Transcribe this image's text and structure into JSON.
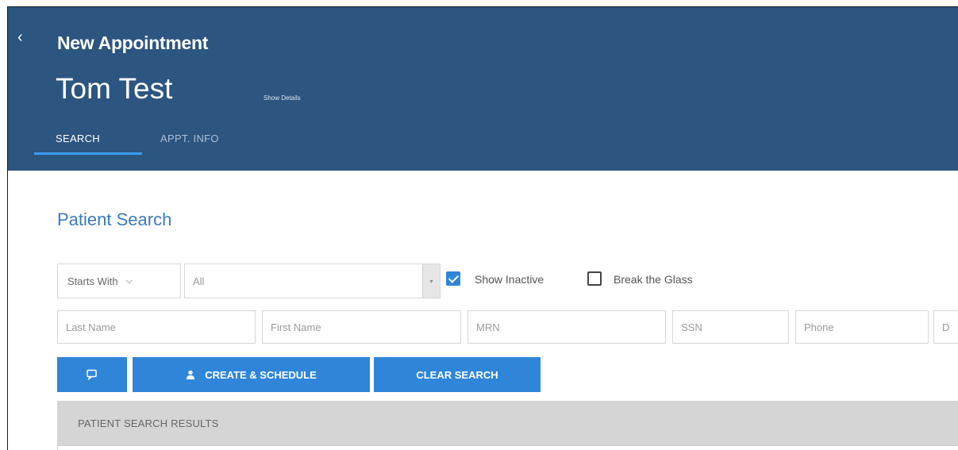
{
  "header": {
    "title": "New Appointment",
    "patient_name": "Tom Test",
    "show_details": "Show Details",
    "tabs": [
      {
        "label": "SEARCH",
        "active": true
      },
      {
        "label": "APPT. INFO",
        "active": false
      }
    ]
  },
  "patient_search": {
    "title": "Patient Search",
    "match_mode": "Starts With",
    "scope": "All",
    "show_inactive": {
      "label": "Show Inactive",
      "checked": true
    },
    "break_glass": {
      "label": "Break the Glass",
      "checked": false
    },
    "fields": [
      {
        "placeholder": "Last Name"
      },
      {
        "placeholder": "First Name"
      },
      {
        "placeholder": "MRN"
      },
      {
        "placeholder": "SSN"
      },
      {
        "placeholder": "Phone"
      },
      {
        "placeholder": "D"
      }
    ],
    "buttons": {
      "search_icon": "search-icon",
      "create_schedule": "CREATE & SCHEDULE",
      "clear_search": "CLEAR SEARCH"
    }
  },
  "results": {
    "header": "PATIENT SEARCH RESULTS"
  },
  "colors": {
    "header_bg": "#2c5580",
    "accent": "#2f86d9",
    "tab_underline": "#3d9cf0",
    "section_title": "#3b7bbd"
  }
}
